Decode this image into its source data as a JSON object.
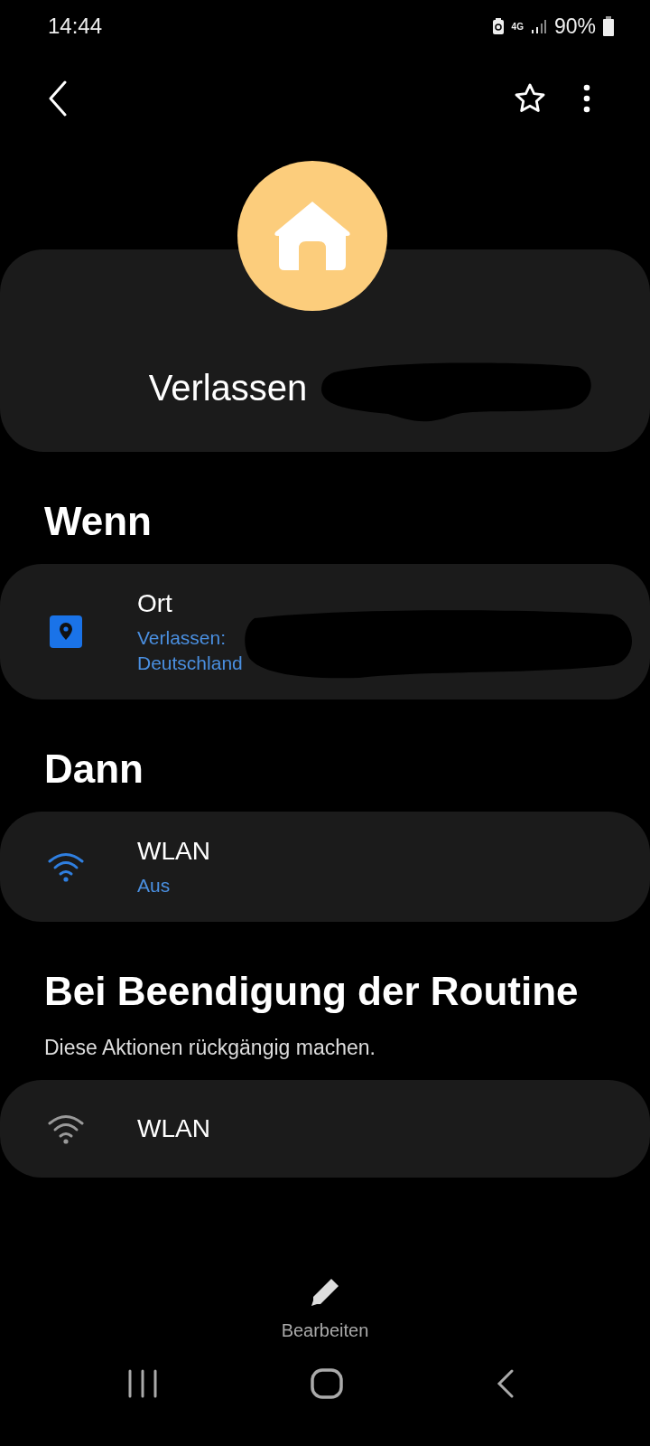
{
  "status_bar": {
    "time": "14:44",
    "network": "4G",
    "battery": "90%"
  },
  "routine": {
    "title": "Verlassen",
    "redacted": true
  },
  "sections": [
    {
      "heading": "Wenn",
      "items": [
        {
          "kind": "location",
          "active": true,
          "title": "Ort",
          "lines": [
            "Verlassen:",
            "Deutschland"
          ],
          "redacted": true
        }
      ]
    },
    {
      "heading": "Dann",
      "items": [
        {
          "kind": "wifi",
          "active": true,
          "title": "WLAN",
          "lines": [
            "Aus"
          ],
          "redacted": false
        }
      ]
    },
    {
      "heading": "Bei Beendigung der Routine",
      "subtitle": "Diese Aktionen rückgängig machen.",
      "items": [
        {
          "kind": "wifi",
          "active": false,
          "title": "WLAN",
          "redacted": false
        }
      ]
    }
  ],
  "edit_button": {
    "label": "Bearbeiten"
  }
}
